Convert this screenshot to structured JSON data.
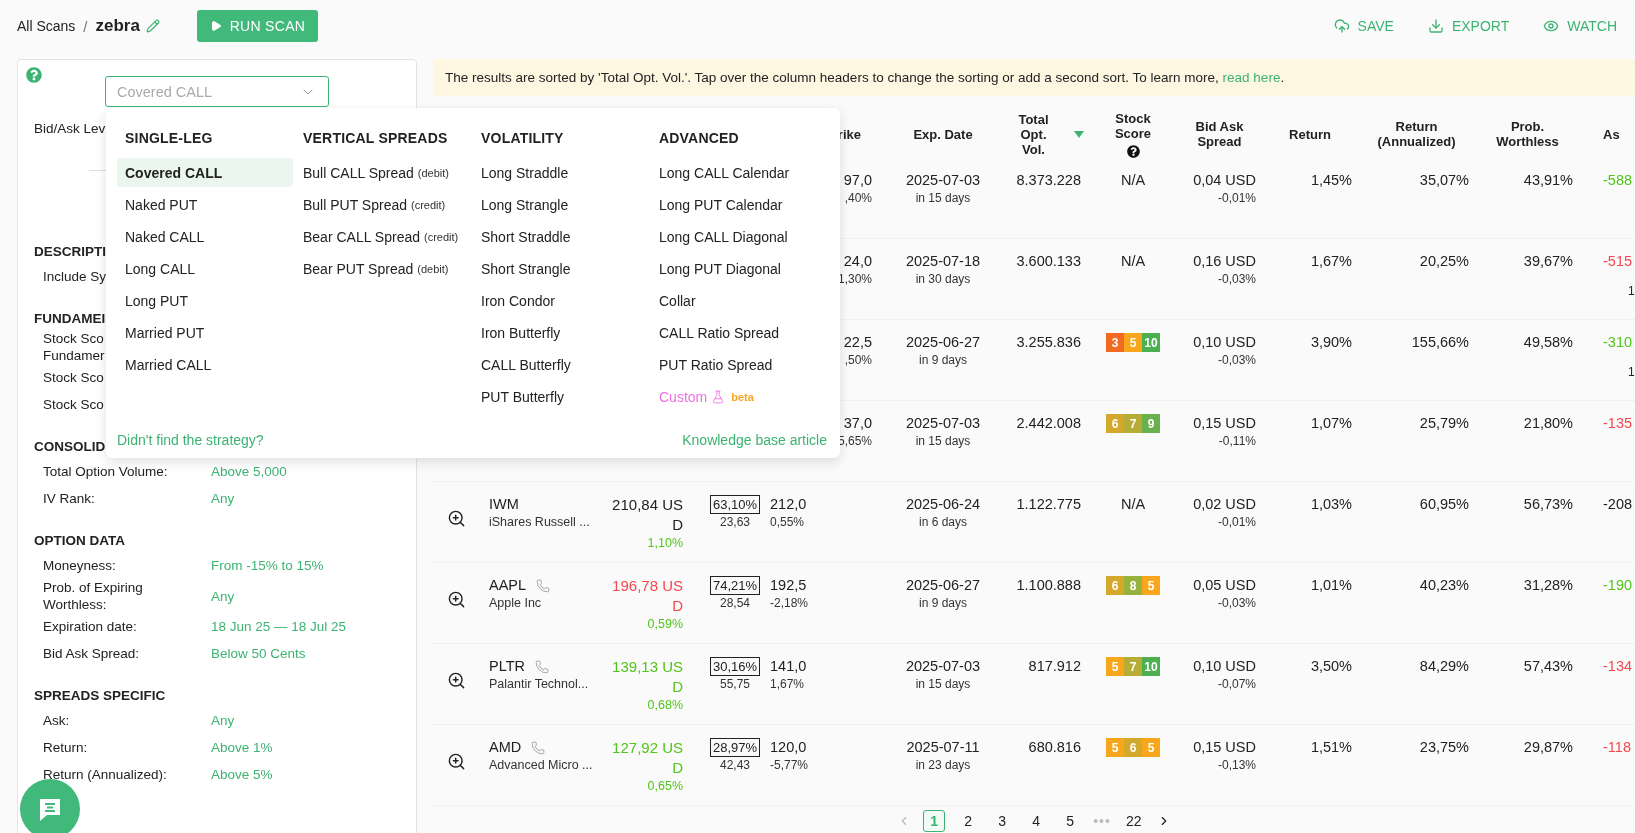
{
  "breadcrumb": {
    "root": "All Scans",
    "separator": "/",
    "current": "zebra"
  },
  "run_button": "RUN SCAN",
  "actions": [
    {
      "kind": "save",
      "label": "SAVE"
    },
    {
      "kind": "export",
      "label": "EXPORT"
    },
    {
      "kind": "watch",
      "label": "WATCH"
    }
  ],
  "strategy_select": {
    "value": "Covered CALL",
    "open": true
  },
  "filters": [
    {
      "rows": [
        {
          "label": "Bid/Ask Lev"
        }
      ]
    },
    {
      "title": "DESCRIPTI",
      "rows": [
        {
          "label": "Include Sy"
        }
      ]
    },
    {
      "title": "FUNDAMEI",
      "rows": [
        {
          "label": "Stock Sco\nFundamer"
        },
        {
          "label": "Stock Sco"
        },
        {
          "label": "Stock Sco"
        }
      ]
    },
    {
      "title": "CONSOLID",
      "rows": [
        {
          "label": "Total Option Volume:",
          "value": "Above 5,000"
        },
        {
          "label": "IV Rank:",
          "value": "Any"
        }
      ]
    },
    {
      "title": "OPTION DATA",
      "rows": [
        {
          "label": "Moneyness:",
          "value": "From -15% to 15%"
        },
        {
          "label": "Prob. of Expiring Worthless:",
          "value": "Any"
        },
        {
          "label": "Expiration date:",
          "value": "18 Jun 25 — 18 Jul 25"
        },
        {
          "label": "Bid Ask Spread:",
          "value": "Below 50 Cents"
        }
      ]
    },
    {
      "title": "SPREADS SPECIFIC",
      "rows": [
        {
          "label": "Ask:",
          "value": "Any"
        },
        {
          "label": "Return:",
          "value": "Above 1%"
        },
        {
          "label": "Return (Annualized):",
          "value": "Above 5%"
        }
      ]
    }
  ],
  "strategy_menu": {
    "columns": [
      {
        "title": "SINGLE-LEG",
        "items": [
          {
            "kind": "plain",
            "label": "Covered CALL",
            "selected": true
          },
          {
            "kind": "plain",
            "label": "Naked PUT",
            "selected": false
          },
          {
            "kind": "plain",
            "label": "Naked CALL",
            "selected": false
          },
          {
            "kind": "plain",
            "label": "Long CALL",
            "selected": false
          },
          {
            "kind": "plain",
            "label": "Long PUT",
            "selected": false
          },
          {
            "kind": "plain",
            "label": "Married PUT",
            "selected": false
          },
          {
            "kind": "plain",
            "label": "Married CALL",
            "selected": false
          }
        ]
      },
      {
        "title": "VERTICAL SPREADS",
        "items": [
          {
            "kind": "plain",
            "label": "Bull CALL Spread",
            "note": "(debit)",
            "selected": false
          },
          {
            "kind": "plain",
            "label": "Bull PUT Spread",
            "note": "(credit)",
            "selected": false
          },
          {
            "kind": "plain",
            "label": "Bear CALL Spread",
            "note": "(credit)",
            "selected": false
          },
          {
            "kind": "plain",
            "label": "Bear PUT Spread",
            "note": "(debit)",
            "selected": false
          }
        ]
      },
      {
        "title": "VOLATILITY",
        "items": [
          {
            "kind": "plain",
            "label": "Long Straddle",
            "selected": false
          },
          {
            "kind": "plain",
            "label": "Long Strangle",
            "selected": false
          },
          {
            "kind": "plain",
            "label": "Short Straddle",
            "selected": false
          },
          {
            "kind": "plain",
            "label": "Short Strangle",
            "selected": false
          },
          {
            "kind": "plain",
            "label": "Iron Condor",
            "selected": false
          },
          {
            "kind": "plain",
            "label": "Iron Butterfly",
            "selected": false
          },
          {
            "kind": "plain",
            "label": "CALL Butterfly",
            "selected": false
          },
          {
            "kind": "plain",
            "label": "PUT Butterfly",
            "selected": false
          }
        ]
      },
      {
        "title": "ADVANCED",
        "items": [
          {
            "kind": "plain",
            "label": "Long CALL Calendar",
            "selected": false
          },
          {
            "kind": "plain",
            "label": "Long PUT Calendar",
            "selected": false
          },
          {
            "kind": "plain",
            "label": "Long CALL Diagonal",
            "selected": false
          },
          {
            "kind": "plain",
            "label": "Long PUT Diagonal",
            "selected": false
          },
          {
            "kind": "plain",
            "label": "Collar",
            "selected": false
          },
          {
            "kind": "plain",
            "label": "CALL Ratio Spread",
            "selected": false
          },
          {
            "kind": "plain",
            "label": "PUT Ratio Spread",
            "selected": false
          },
          {
            "kind": "custom",
            "label": "Custom",
            "badge": "beta",
            "selected": false
          }
        ]
      }
    ],
    "help_link": "Didn't find the strategy?",
    "kb_link": "Knowledge base article"
  },
  "banner": {
    "text": "The results are sorted by 'Total Opt. Vol.'. Tap over the column headers to change the sorting or add a second sort. To learn more, ",
    "link": "read here",
    "end": "."
  },
  "table": {
    "columns": [
      {
        "kind": "plain",
        "label": "rike",
        "sorted": false
      },
      {
        "kind": "plain",
        "label": "Exp. Date",
        "sorted": false
      },
      {
        "kind": "plain",
        "label": "Total Opt. Vol.",
        "sorted": true
      },
      {
        "kind": "help",
        "label": "Stock Score",
        "sorted": false
      },
      {
        "kind": "plain",
        "label": "Bid Ask Spread",
        "sorted": false
      },
      {
        "kind": "plain",
        "label": "Return",
        "sorted": false
      },
      {
        "kind": "plain",
        "label": "Return (Annualized)",
        "sorted": false
      },
      {
        "kind": "plain",
        "label": "Prob. Worthless",
        "sorted": false
      },
      {
        "kind": "plain",
        "label": "As",
        "sorted": false
      }
    ],
    "rows": [
      {
        "strike": "97,0",
        "strike_change": ",40%",
        "exp": "2025-07-03",
        "days": "in 15 days",
        "volume": "8.373.228",
        "score": {
          "kind": "text",
          "text": "N/A"
        },
        "spread": "0,04 USD",
        "spread_change": "-0,01%",
        "return": "1,45%",
        "annualized": "35,07%",
        "prob": "43,91%",
        "ask": {
          "text": "-588",
          "color": "#52c41a"
        }
      },
      {
        "strike": "24,0",
        "strike_change": "1,30%",
        "exp": "2025-07-18",
        "days": "in 30 days",
        "volume": "3.600.133",
        "score": {
          "kind": "text",
          "text": "N/A"
        },
        "spread": "0,16 USD",
        "spread_change": "-0,03%",
        "return": "1,67%",
        "annualized": "20,25%",
        "prob": "39,67%",
        "ask": {
          "text": "-515",
          "color": "#f5474f"
        },
        "ask_sub": "1"
      },
      {
        "strike": "22,5",
        "strike_change": ",50%",
        "exp": "2025-06-27",
        "days": "in 9 days",
        "volume": "3.255.836",
        "score": {
          "kind": "chips",
          "chips": [
            {
              "value": "3",
              "color": "#f26a21"
            },
            {
              "value": "5",
              "color": "#f8a71c"
            },
            {
              "value": "10",
              "color": "#4caf50"
            }
          ]
        },
        "spread": "0,10 USD",
        "spread_change": "-0,03%",
        "return": "3,90%",
        "annualized": "155,66%",
        "prob": "49,58%",
        "ask": {
          "text": "-310",
          "color": "#52c41a"
        },
        "ask_sub": "1"
      },
      {
        "strike": "37,0",
        "strike_change": "5,65%",
        "exp": "2025-07-03",
        "days": "in 15 days",
        "volume": "2.442.008",
        "score": {
          "kind": "chips",
          "chips": [
            {
              "value": "6",
              "color": "#d4a82a"
            },
            {
              "value": "7",
              "color": "#b5ad35"
            },
            {
              "value": "9",
              "color": "#6ab04c"
            }
          ]
        },
        "spread": "0,15 USD",
        "spread_change": "-0,11%",
        "return": "1,07%",
        "annualized": "25,79%",
        "prob": "21,80%",
        "ask": {
          "text": "-135",
          "color": "#f5474f"
        }
      },
      {
        "symbol": "IWM",
        "name": "iShares Russell ...",
        "earnings_call": false,
        "price": {
          "text": "210,84 USD",
          "color": "#222222"
        },
        "price_change": "1,10%",
        "iv": "63,10%",
        "iv_sub": "23,63",
        "strike": "212,0",
        "strike_change": "0,55%",
        "exp": "2025-06-24",
        "days": "in 6 days",
        "volume": "1.122.775",
        "score": {
          "kind": "text",
          "text": "N/A"
        },
        "spread": "0,02 USD",
        "spread_change": "-0,01%",
        "return": "1,03%",
        "annualized": "60,95%",
        "prob": "56,73%",
        "ask": {
          "text": "-208",
          "color": "#222222"
        }
      },
      {
        "symbol": "AAPL",
        "name": "Apple Inc",
        "earnings_call": true,
        "price": {
          "text": "196,78 USD",
          "color": "#f5474f"
        },
        "price_change": "0,59%",
        "iv": "74,21%",
        "iv_sub": "28,54",
        "strike": "192,5",
        "strike_change": "-2,18%",
        "exp": "2025-06-27",
        "days": "in 9 days",
        "volume": "1.100.888",
        "score": {
          "kind": "chips",
          "chips": [
            {
              "value": "6",
              "color": "#d4a82a"
            },
            {
              "value": "8",
              "color": "#96b23c"
            },
            {
              "value": "5",
              "color": "#f8a71c"
            }
          ]
        },
        "spread": "0,05 USD",
        "spread_change": "-0,03%",
        "return": "1,01%",
        "annualized": "40,23%",
        "prob": "31,28%",
        "ask": {
          "text": "-190",
          "color": "#52c41a"
        }
      },
      {
        "symbol": "PLTR",
        "name": "Palantir Technol...",
        "earnings_call": true,
        "price": {
          "text": "139,13 USD",
          "color": "#52c41a"
        },
        "price_change": "0,68%",
        "iv": "30,16%",
        "iv_sub": "55,75",
        "strike": "141,0",
        "strike_change": "1,67%",
        "exp": "2025-07-03",
        "days": "in 15 days",
        "volume": "817.912",
        "score": {
          "kind": "chips",
          "chips": [
            {
              "value": "5",
              "color": "#f8a71c"
            },
            {
              "value": "7",
              "color": "#b5ad35"
            },
            {
              "value": "10",
              "color": "#4caf50"
            }
          ]
        },
        "spread": "0,10 USD",
        "spread_change": "-0,07%",
        "return": "3,50%",
        "annualized": "84,29%",
        "prob": "57,43%",
        "ask": {
          "text": "-134",
          "color": "#f5474f"
        }
      },
      {
        "symbol": "AMD",
        "name": "Advanced Micro ...",
        "earnings_call": true,
        "price": {
          "text": "127,92 USD",
          "color": "#52c41a"
        },
        "price_change": "0,65%",
        "iv": "28,97%",
        "iv_sub": "42,43",
        "strike": "120,0",
        "strike_change": "-5,77%",
        "exp": "2025-07-11",
        "days": "in 23 days",
        "volume": "680.816",
        "score": {
          "kind": "chips",
          "chips": [
            {
              "value": "5",
              "color": "#f8a71c"
            },
            {
              "value": "6",
              "color": "#d4a82a"
            },
            {
              "value": "5",
              "color": "#f8a71c"
            }
          ]
        },
        "spread": "0,15 USD",
        "spread_change": "-0,13%",
        "return": "1,51%",
        "annualized": "23,75%",
        "prob": "29,87%",
        "ask": {
          "text": "-118",
          "color": "#f5474f"
        }
      }
    ]
  },
  "pagination": {
    "prev_disabled": true,
    "items": [
      {
        "kind": "page",
        "label": "1",
        "selected": true
      },
      {
        "kind": "page",
        "label": "2",
        "selected": false
      },
      {
        "kind": "page",
        "label": "3",
        "selected": false
      },
      {
        "kind": "page",
        "label": "4",
        "selected": false
      },
      {
        "kind": "page",
        "label": "5",
        "selected": false
      },
      {
        "kind": "gap",
        "label": "•••"
      },
      {
        "kind": "page",
        "label": "22",
        "selected": false
      }
    ]
  }
}
